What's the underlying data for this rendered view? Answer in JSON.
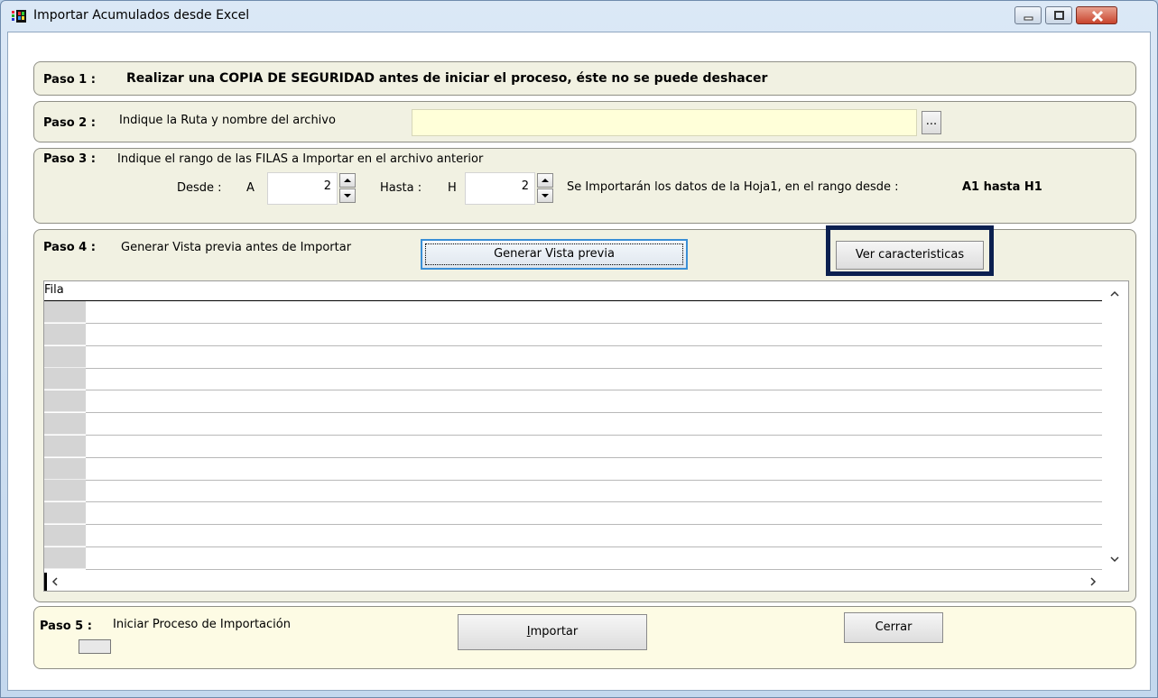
{
  "window": {
    "title": "Importar Acumulados desde Excel"
  },
  "paso1": {
    "label": "Paso 1 :",
    "text": "Realizar una COPIA DE SEGURIDAD antes de iniciar el proceso, éste no se puede deshacer"
  },
  "paso2": {
    "label": "Paso 2 :",
    "text": "Indique la Ruta y nombre del archivo",
    "path_value": "",
    "browse_label": "..."
  },
  "paso3": {
    "label": "Paso 3 :",
    "text": "Indique el rango de las FILAS a Importar en el archivo anterior",
    "desde_label": "Desde :",
    "desde_col": "A",
    "desde_value": "2",
    "hasta_label": "Hasta :",
    "hasta_col": "H",
    "hasta_value": "2",
    "range_text": "Se Importarán los datos de la Hoja1,  en el rango desde :",
    "range_value": "A1 hasta H1"
  },
  "paso4": {
    "label": "Paso 4 :",
    "text": "Generar Vista previa antes de Importar",
    "preview_button": "Generar Vista previa",
    "features_button": "Ver caracteristicas",
    "grid": {
      "column_header": "Fila",
      "rows": [
        "",
        "",
        "",
        "",
        "",
        "",
        "",
        "",
        "",
        "",
        "",
        ""
      ]
    }
  },
  "paso5": {
    "label": "Paso 5 :",
    "text": "Iniciar Proceso de Importación",
    "importar_first": "I",
    "importar_rest": "mportar",
    "cerrar_button": "Cerrar"
  },
  "colors": {
    "group_bg": "#f1f1e2",
    "paso5_bg": "#fdfbe4",
    "input_bg": "#ffffd9",
    "highlight": "#0b2050",
    "focus_border": "#3a8fd6"
  }
}
